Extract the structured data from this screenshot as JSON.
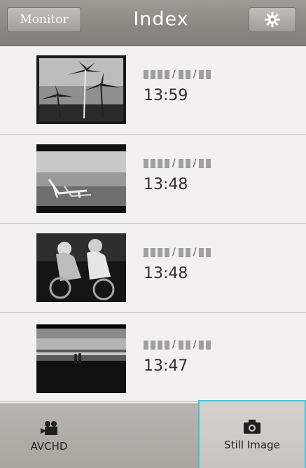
{
  "header": {
    "monitor_label": "Monitor",
    "title": "Index",
    "settings_icon": "gear-icon"
  },
  "items": [
    {
      "thumbnail": "palm-trees-photo",
      "date": "▮▮▮▮/▮▮/▮▮",
      "time": "13:59"
    },
    {
      "thumbnail": "beach-chairs-photo",
      "date": "▮▮▮▮/▮▮/▮▮",
      "time": "13:48"
    },
    {
      "thumbnail": "cyclists-photo",
      "date": "▮▮▮▮/▮▮/▮▮",
      "time": "13:48"
    },
    {
      "thumbnail": "sunset-couple-photo",
      "date": "▮▮▮▮/▮▮/▮▮",
      "time": "13:47"
    }
  ],
  "tabs": [
    {
      "label": "AVCHD",
      "icon": "video-camera-icon",
      "selected": false
    },
    {
      "label": "Still Image",
      "icon": "camera-icon",
      "selected": true
    }
  ],
  "colors": {
    "header": "#8e8883",
    "background": "#f2f1ef",
    "selected_outline": "#45c4d6"
  }
}
